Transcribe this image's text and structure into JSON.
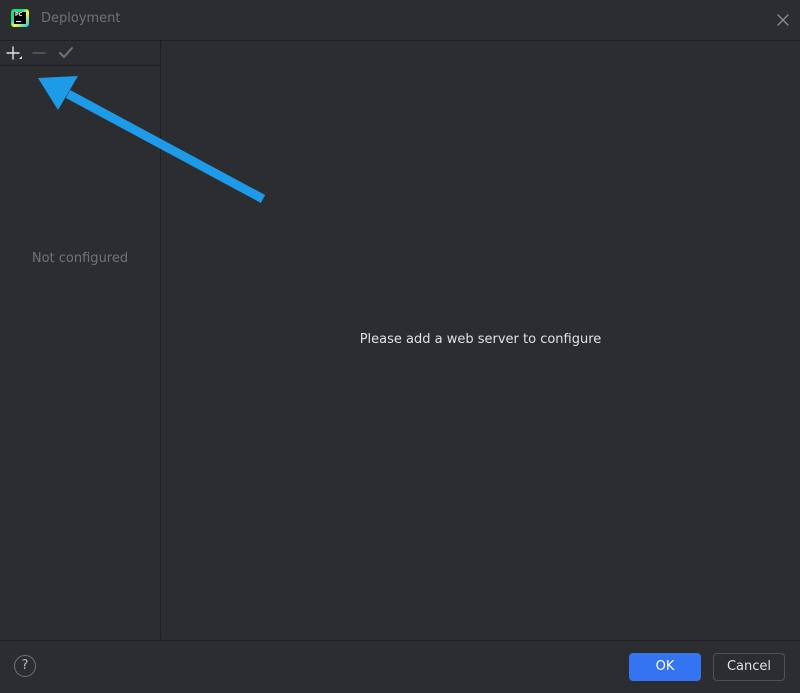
{
  "window": {
    "title": "Deployment",
    "app_icon_text": "PC"
  },
  "left_panel": {
    "toolbar": {
      "add_icon": "plus-icon",
      "remove_icon": "minus-icon",
      "check_icon": "check-icon"
    },
    "empty_text": "Not configured"
  },
  "right_panel": {
    "placeholder": "Please add a web server to configure"
  },
  "footer": {
    "help_label": "?",
    "ok_label": "OK",
    "cancel_label": "Cancel"
  },
  "colors": {
    "background": "#2b2d30",
    "accent": "#3574f0",
    "annotation_arrow": "#1e9be8"
  }
}
